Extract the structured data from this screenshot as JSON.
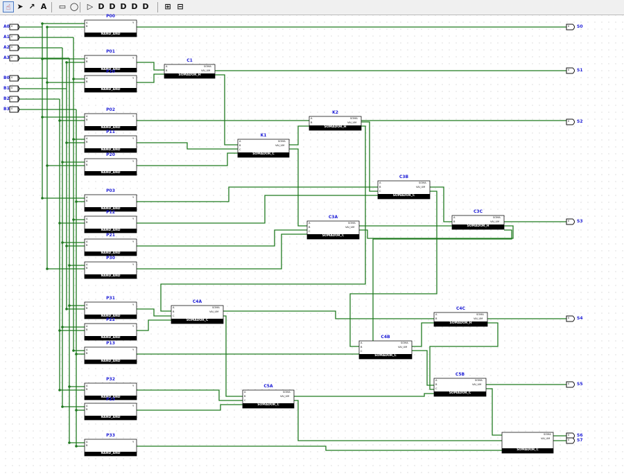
{
  "toolbar": {
    "tools": [
      {
        "name": "poke-tool",
        "glyph": "☝",
        "selected": true
      },
      {
        "name": "select-tool",
        "glyph": "➤",
        "selected": false
      },
      {
        "name": "wiring-tool",
        "glyph": "↗",
        "selected": false
      },
      {
        "name": "text-tool",
        "glyph": "A",
        "selected": false
      },
      {
        "name": "input-pin-tool",
        "glyph": "▭",
        "selected": false
      },
      {
        "name": "output-pin-tool",
        "glyph": "◯",
        "selected": false
      },
      {
        "name": "not-gate-tool",
        "glyph": "▷",
        "selected": false
      },
      {
        "name": "and-gate-tool",
        "glyph": "D",
        "selected": false
      },
      {
        "name": "or-gate-tool",
        "glyph": "D",
        "selected": false
      },
      {
        "name": "xor-gate-tool",
        "glyph": "D",
        "selected": false
      },
      {
        "name": "nand-gate-tool",
        "glyph": "D",
        "selected": false
      },
      {
        "name": "nor-gate-tool",
        "glyph": "D",
        "selected": false
      },
      {
        "name": "subcircuit-tool",
        "glyph": "⊞",
        "selected": false
      },
      {
        "name": "splitter-tool",
        "glyph": "⊟",
        "selected": false
      }
    ]
  },
  "inputs": [
    "A0",
    "A1",
    "A2",
    "A3",
    "B0",
    "B1",
    "B2",
    "B3"
  ],
  "input_value": "0",
  "outputs": [
    "S0",
    "S1",
    "S2",
    "S3",
    "S4",
    "S5",
    "S6",
    "S7"
  ],
  "nand_and": {
    "footer": "NAND_AND",
    "instances": [
      "P00",
      "P01",
      "P10",
      "P02",
      "P11",
      "P20",
      "P03",
      "P12",
      "P21",
      "P30",
      "P31",
      "P22",
      "P13",
      "P32",
      "P23",
      "P33"
    ]
  },
  "somador_h": {
    "footer": "SOMADOR_H",
    "instances": [
      "C1",
      "K2",
      "C3C",
      "C4C"
    ]
  },
  "somador_c": {
    "footer": "SOMADOR_C",
    "instances": [
      "K1",
      "C3B",
      "C3A",
      "C4A",
      "C4B",
      "C5B",
      "C5A"
    ]
  },
  "ports": {
    "a": "A",
    "b": "B",
    "y": "Y",
    "c": "C",
    "soma": "SOMA",
    "vai_um": "VAI_UM"
  },
  "colors": {
    "wire_active": "#1f7a1f",
    "component_footer": "#000000",
    "label_blue": "#1a1ad6",
    "tool_selected": "#dbe6f7"
  }
}
